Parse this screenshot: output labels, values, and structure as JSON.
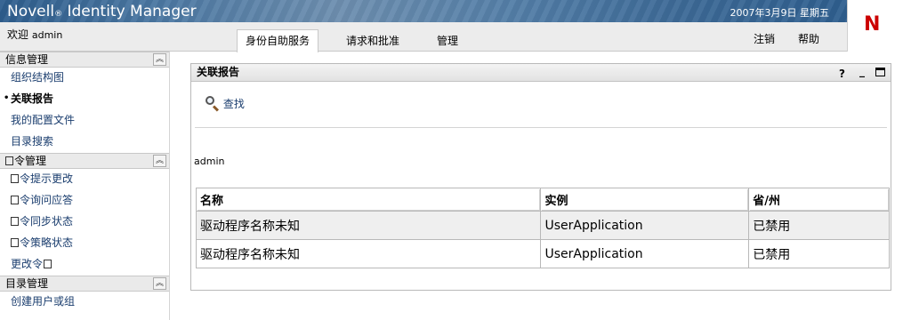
{
  "header": {
    "brand": "Novell",
    "brand_mark": "®",
    "product": "Identity Manager",
    "date": "2007年3月9日 星期五",
    "logo_letter": "N"
  },
  "nav": {
    "welcome": "欢迎",
    "user": "admin",
    "tabs": [
      "身份自助服务",
      "请求和批准",
      "管理"
    ],
    "active_tab": "身份自助服务",
    "logout": "注销",
    "help": "帮助"
  },
  "sidebar": {
    "groups": [
      {
        "title": "信息管理",
        "items": [
          "组织结构图",
          "关联报告",
          "我的配置文件",
          "目录搜索"
        ],
        "active": "关联报告"
      },
      {
        "title": "令管理",
        "items": [
          "令提示更改",
          "令询问应答",
          "令同步状态",
          "令策略状态",
          "更改令"
        ]
      },
      {
        "title": "目录管理",
        "items": [
          "创建用户或组"
        ]
      }
    ],
    "collapse_icon": "double-chevron-up-icon"
  },
  "portlet": {
    "title": "关联报告",
    "controls": {
      "help": "?",
      "minimize": "_",
      "maximize": "maximize-icon"
    },
    "search_label": "查找",
    "user_label": "admin",
    "table": {
      "headers": [
        "名称",
        "实例",
        "省/州"
      ],
      "rows": [
        [
          "驱动程序名称未知",
          "UserApplication",
          "已禁用"
        ],
        [
          "驱动程序名称未知",
          "UserApplication",
          "已禁用"
        ]
      ]
    }
  },
  "colors": {
    "banner": "#3d6a97",
    "logo": "#cc0000",
    "link": "#1a3d6e",
    "row_alt": "#efefef"
  }
}
